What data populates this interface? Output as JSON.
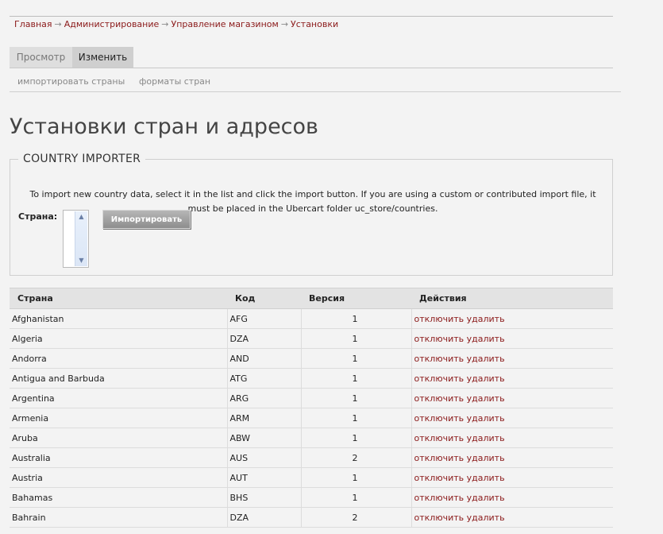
{
  "breadcrumb": {
    "items": [
      "Главная",
      "Администрирование",
      "Управление магазином",
      "Установки"
    ],
    "separator": "→"
  },
  "tabs": {
    "primary": [
      "Просмотр",
      "Изменить"
    ],
    "active": "Изменить",
    "secondary": [
      "импортировать страны",
      "форматы стран"
    ]
  },
  "page_title": "Установки стран и адресов",
  "importer": {
    "legend": "COUNTRY IMPORTER",
    "description": "To import new country data, select it in the list and click the import button. If you are using a custom or contributed import file, it must be placed in the Ubercart folder uc_store/countries.",
    "country_label": "Страна:",
    "import_button": "Импортировать"
  },
  "table": {
    "headers": [
      "Страна",
      "Код",
      "Версия",
      "Действия"
    ],
    "actions": [
      "отключить",
      "удалить"
    ],
    "rows": [
      {
        "country": "Afghanistan",
        "code": "AFG",
        "version": "1"
      },
      {
        "country": "Algeria",
        "code": "DZA",
        "version": "1"
      },
      {
        "country": "Andorra",
        "code": "AND",
        "version": "1"
      },
      {
        "country": "Antigua and Barbuda",
        "code": "ATG",
        "version": "1"
      },
      {
        "country": "Argentina",
        "code": "ARG",
        "version": "1"
      },
      {
        "country": "Armenia",
        "code": "ARM",
        "version": "1"
      },
      {
        "country": "Aruba",
        "code": "ABW",
        "version": "1"
      },
      {
        "country": "Australia",
        "code": "AUS",
        "version": "2"
      },
      {
        "country": "Austria",
        "code": "AUT",
        "version": "1"
      },
      {
        "country": "Bahamas",
        "code": "BHS",
        "version": "1"
      },
      {
        "country": "Bahrain",
        "code": "DZA",
        "version": "2"
      }
    ]
  },
  "colors": {
    "link": "#8b1a1a",
    "background": "#f3f3f3",
    "header_bg": "#e3e3e3"
  }
}
